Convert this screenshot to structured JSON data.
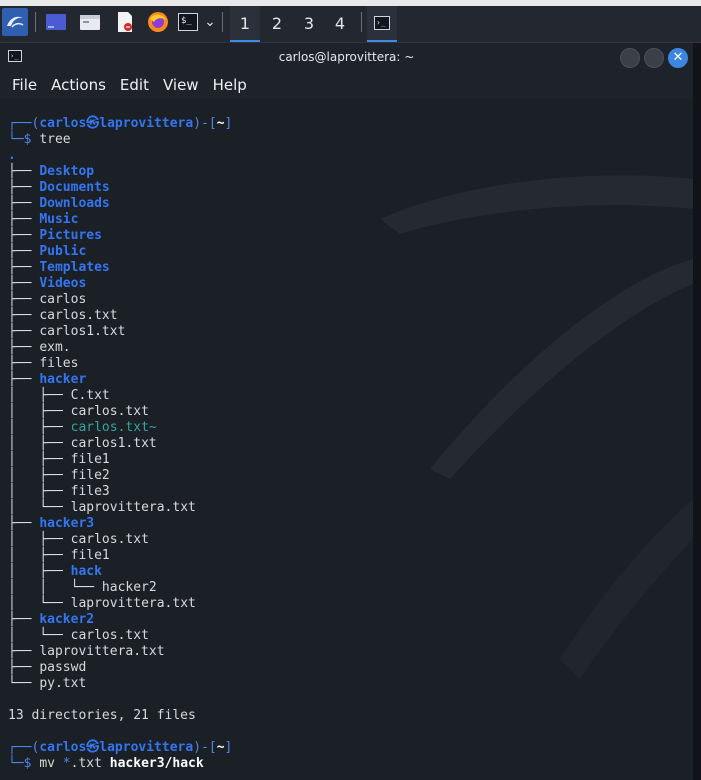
{
  "panel": {
    "workspaces": [
      "1",
      "2",
      "3",
      "4"
    ],
    "active_workspace": "1",
    "terminal_glyph": "$_",
    "dropdown_glyph": "⌄"
  },
  "window": {
    "title": "carlos@laprovittera: ~",
    "close_glyph": "✕"
  },
  "menu": [
    "File",
    "Actions",
    "Edit",
    "View",
    "Help"
  ],
  "terminal": {
    "prompt1": {
      "user": "carlos",
      "at": "㉿",
      "host": "laprovittera",
      "cwd": "~",
      "command": "tree"
    },
    "tree": [
      {
        "prefix": ".",
        "name": "",
        "type": "root"
      },
      {
        "prefix": "├── ",
        "name": "Desktop",
        "type": "dir"
      },
      {
        "prefix": "├── ",
        "name": "Documents",
        "type": "dir"
      },
      {
        "prefix": "├── ",
        "name": "Downloads",
        "type": "dir"
      },
      {
        "prefix": "├── ",
        "name": "Music",
        "type": "dir"
      },
      {
        "prefix": "├── ",
        "name": "Pictures",
        "type": "dir"
      },
      {
        "prefix": "├── ",
        "name": "Public",
        "type": "dir"
      },
      {
        "prefix": "├── ",
        "name": "Templates",
        "type": "dir"
      },
      {
        "prefix": "├── ",
        "name": "Videos",
        "type": "dir"
      },
      {
        "prefix": "├── ",
        "name": "carlos",
        "type": "file"
      },
      {
        "prefix": "├── ",
        "name": "carlos.txt",
        "type": "file"
      },
      {
        "prefix": "├── ",
        "name": "carlos1.txt",
        "type": "file"
      },
      {
        "prefix": "├── ",
        "name": "exm.",
        "type": "file"
      },
      {
        "prefix": "├── ",
        "name": "files",
        "type": "file"
      },
      {
        "prefix": "├── ",
        "name": "hacker",
        "type": "dir"
      },
      {
        "prefix": "│   ├── ",
        "name": "C.txt",
        "type": "file"
      },
      {
        "prefix": "│   ├── ",
        "name": "carlos.txt",
        "type": "file"
      },
      {
        "prefix": "│   ├── ",
        "name": "carlos.txt~",
        "type": "backup"
      },
      {
        "prefix": "│   ├── ",
        "name": "carlos1.txt",
        "type": "file"
      },
      {
        "prefix": "│   ├── ",
        "name": "file1",
        "type": "file"
      },
      {
        "prefix": "│   ├── ",
        "name": "file2",
        "type": "file"
      },
      {
        "prefix": "│   ├── ",
        "name": "file3",
        "type": "file"
      },
      {
        "prefix": "│   └── ",
        "name": "laprovittera.txt",
        "type": "file"
      },
      {
        "prefix": "├── ",
        "name": "hacker3",
        "type": "dir"
      },
      {
        "prefix": "│   ├── ",
        "name": "carlos.txt",
        "type": "file"
      },
      {
        "prefix": "│   ├── ",
        "name": "file1",
        "type": "file"
      },
      {
        "prefix": "│   ├── ",
        "name": "hack",
        "type": "dir"
      },
      {
        "prefix": "│   │   └── ",
        "name": "hacker2",
        "type": "file"
      },
      {
        "prefix": "│   └── ",
        "name": "laprovittera.txt",
        "type": "file"
      },
      {
        "prefix": "├── ",
        "name": "kacker2",
        "type": "dir"
      },
      {
        "prefix": "│   └── ",
        "name": "carlos.txt",
        "type": "file"
      },
      {
        "prefix": "├── ",
        "name": "laprovittera.txt",
        "type": "file"
      },
      {
        "prefix": "├── ",
        "name": "passwd",
        "type": "file"
      },
      {
        "prefix": "└── ",
        "name": "py.txt",
        "type": "file"
      }
    ],
    "summary": "13 directories, 21 files",
    "prompt2": {
      "user": "carlos",
      "at": "㉿",
      "host": "laprovittera",
      "cwd": "~",
      "cmd_name": "mv",
      "cmd_glob": "*",
      "cmd_rest": ".txt ",
      "cmd_target": "hacker3/hack"
    }
  }
}
